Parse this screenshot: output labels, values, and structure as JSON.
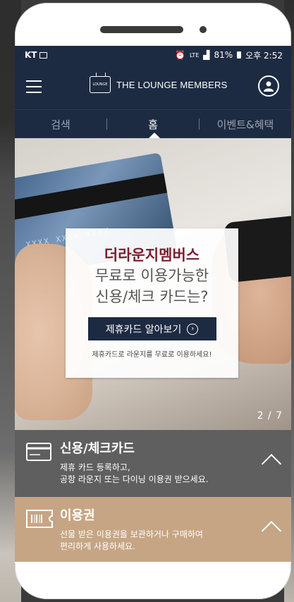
{
  "statusbar": {
    "carrier": "KT",
    "signal": "LTE",
    "battery": "81%",
    "time": "오후 2:52"
  },
  "header": {
    "logo_small": "LOUNGE",
    "brand": "THE LOUNGE MEMBERS"
  },
  "tabs": [
    {
      "label": "검색"
    },
    {
      "label": "홈"
    },
    {
      "label": "이벤트&혜택"
    }
  ],
  "hero": {
    "card_text": "XXXX XXXX XXXX",
    "title": "더라운지멤버스",
    "line1": "무료로 이용가능한",
    "line2": "신용/체크 카드는?",
    "button": "제휴카드 알아보기",
    "note": "제휴카드로 라운지를 무료로 이용하세요!",
    "pager": "2 / 7"
  },
  "sections": {
    "card": {
      "title": "신용/체크카드",
      "desc1": "제휴 카드 등록하고,",
      "desc2": "공항 라운지 또는 다이닝 이용권 받으세요."
    },
    "ticket": {
      "title": "이용권",
      "desc1": "선물 받은 이용권을 보관하거나 구매하여",
      "desc2": "편리하게 사용하세요."
    }
  },
  "colors": {
    "navy": "#1d2b42",
    "card_section": "#5f5f5f",
    "ticket_section": "#c6a584",
    "promo_title": "#7a1f2e"
  }
}
